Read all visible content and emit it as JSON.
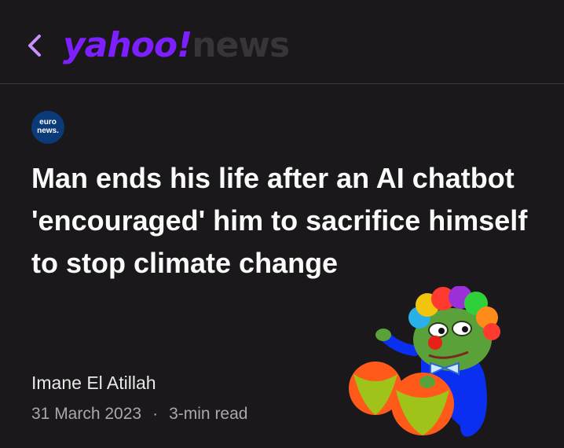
{
  "header": {
    "logo_brand": "yahoo!",
    "logo_product": "news"
  },
  "source": {
    "logo_line1": "euro",
    "logo_line2": "news."
  },
  "article": {
    "headline": "Man ends his life after an AI chatbot 'encouraged' him to sacrifice himself to stop climate change",
    "author": "Imane El Atillah",
    "date": "31 March 2023",
    "separator": "·",
    "read_time": "3-min read"
  },
  "colors": {
    "background": "#1a181b",
    "brand_purple": "#7e1fff",
    "back_arrow": "#c792ff",
    "source_blue": "#0a3b78"
  },
  "icons": {
    "back": "chevron-left-icon",
    "sticker": "clown-frog-sticker"
  }
}
